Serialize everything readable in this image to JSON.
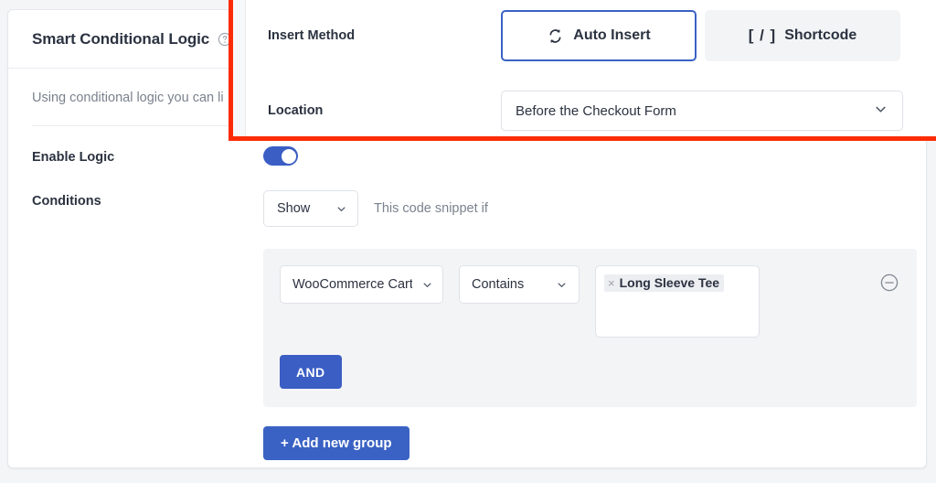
{
  "card": {
    "title": "Smart Conditional Logic",
    "help_icon": "question-circle-icon",
    "description": "Using conditional logic you can li",
    "rows": {
      "enable_logic_label": "Enable Logic",
      "enable_logic_state": "on",
      "conditions_label": "Conditions",
      "conditions_select_value": "Show",
      "conditions_hint": "This code snippet if"
    },
    "condition_group": {
      "subject": "WooCommerce Cart",
      "operator": "Contains",
      "tags": [
        {
          "remove_glyph": "×",
          "label": "Long Sleeve Tee"
        }
      ],
      "remove_icon": "minus-circle-icon",
      "and_button": "AND"
    },
    "add_group_button": "+ Add new group"
  },
  "overlay": {
    "highlight_color": "#fb2c05",
    "insert_method": {
      "label": "Insert Method",
      "options": [
        {
          "label": "Auto Insert",
          "icon": "sync-refresh-icon",
          "selected": true
        },
        {
          "label": "Shortcode",
          "icon": "[ / ]",
          "selected": false
        }
      ]
    },
    "location": {
      "label": "Location",
      "value": "Before the Checkout Form",
      "chevron_icon": "chevron-down-icon"
    }
  },
  "colors": {
    "accent_blue": "#3a5ec4",
    "button_blue": "#3a62c4",
    "highlight_red": "#fb2c05",
    "group_bg": "#f3f4f6"
  }
}
